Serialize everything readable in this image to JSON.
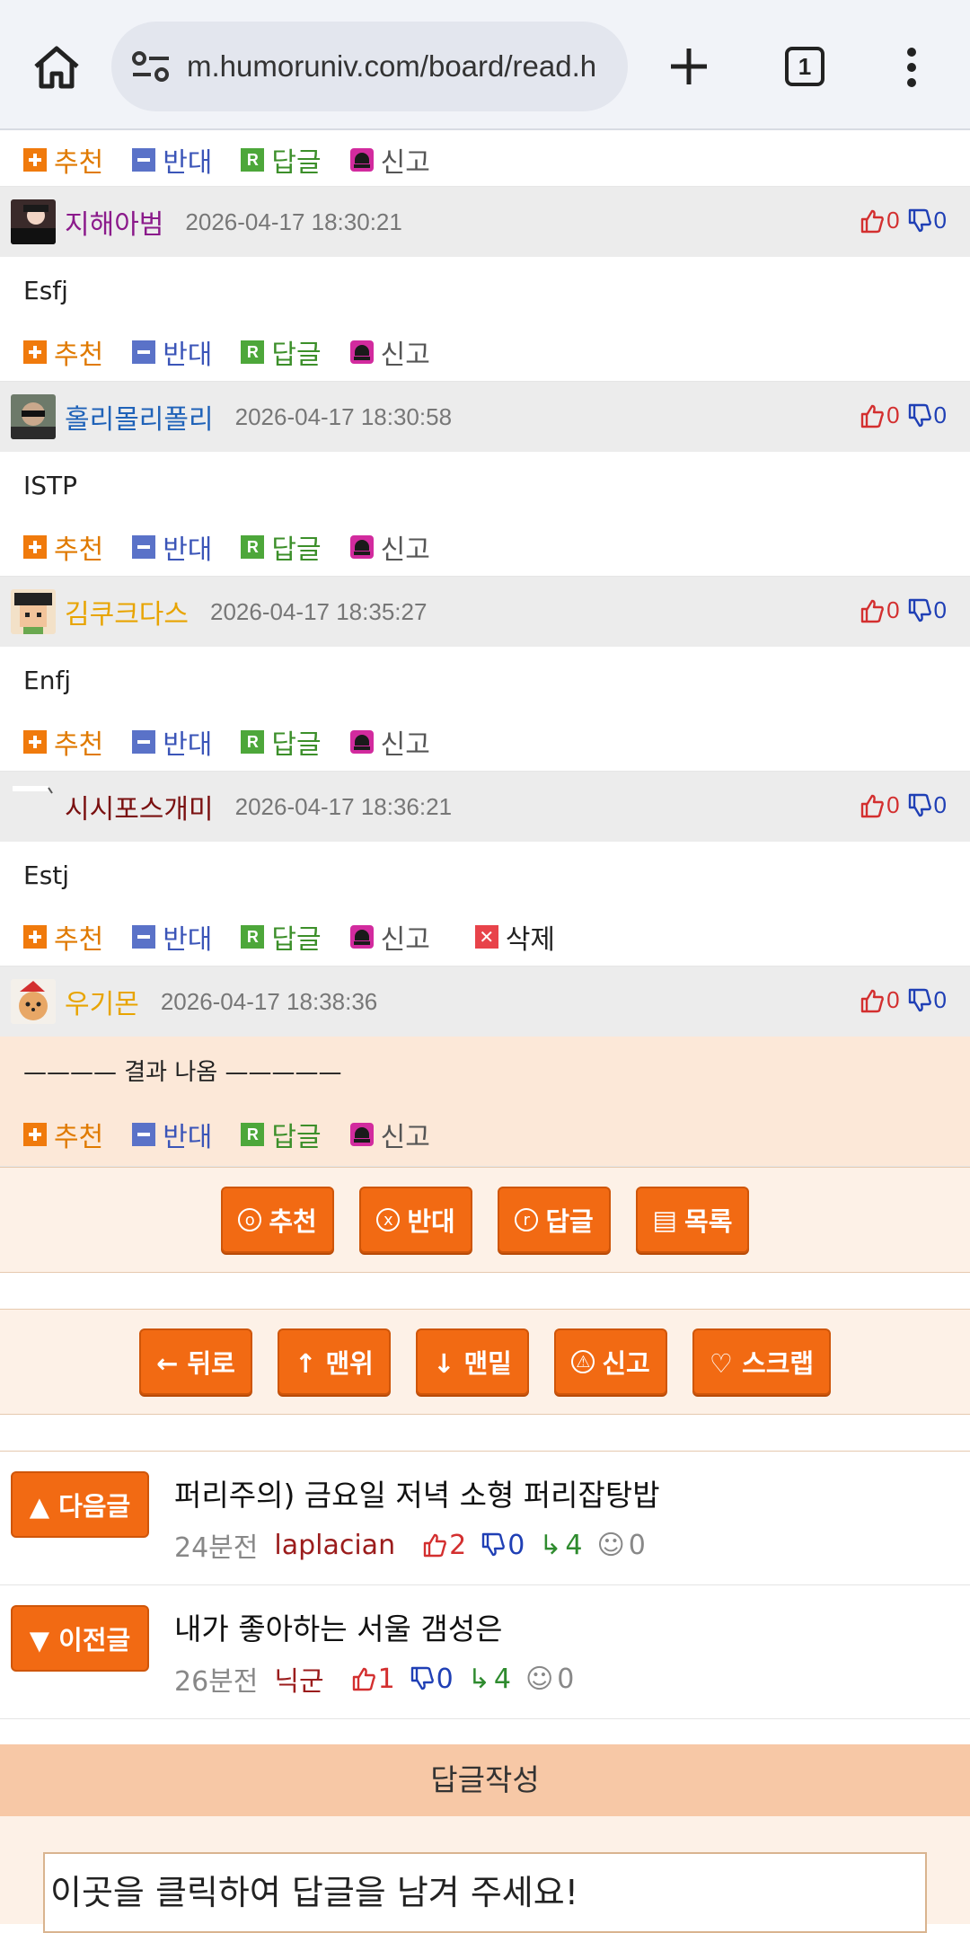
{
  "browser": {
    "url": "m.humoruniv.com/board/read.h",
    "tab_count": "1"
  },
  "actions": {
    "recommend": "추천",
    "oppose": "반대",
    "reply": "답글",
    "report": "신고",
    "delete": "삭제"
  },
  "top_actions_visible": true,
  "comments": [
    {
      "nick": "지해아범",
      "nick_color": "#8b1a8b",
      "date": "2026-04-17 18:30:21",
      "up": "0",
      "down": "0",
      "body": "Esfj"
    },
    {
      "nick": "홀리몰리폴리",
      "nick_color": "#1f62b8",
      "date": "2026-04-17 18:30:58",
      "up": "0",
      "down": "0",
      "body": "ISTP"
    },
    {
      "nick": "김쿠크다스",
      "nick_color": "#e8a400",
      "date": "2026-04-17 18:35:27",
      "up": "0",
      "down": "0",
      "body": "Enfj"
    },
    {
      "nick": "시시포스개미",
      "nick_color": "#7a1010",
      "date": "2026-04-17 18:36:21",
      "up": "0",
      "down": "0",
      "body": "Estj"
    },
    {
      "nick": "우기몬",
      "nick_color": "#e8a400",
      "date": "2026-04-17 18:38:36",
      "up": "0",
      "down": "0",
      "body": "———— 결과 나옴 —————"
    }
  ],
  "post_buttons": {
    "recommend": "추천",
    "oppose": "반대",
    "reply": "답글",
    "list": "목록"
  },
  "nav_buttons": {
    "back": "← 뒤로",
    "top": "↑ 맨위",
    "bottom": "↓ 맨밑",
    "report": "신고",
    "scrap": "♡ 스크랩"
  },
  "next_post": {
    "button": "▲ 다음글",
    "title": "퍼리주의) 금요일 저녁 소형 퍼리잡탕밥",
    "ago": "24분전",
    "author": "laplacian",
    "up": "2",
    "down": "0",
    "replies": "4",
    "views": "0"
  },
  "prev_post": {
    "button": "▼ 이전글",
    "title": "내가 좋아하는 서울 갬성은",
    "ago": "26분전",
    "author": "닉군",
    "up": "1",
    "down": "0",
    "replies": "4",
    "views": "0"
  },
  "reply_write": {
    "header": "답글작성",
    "placeholder": "이곳을 클릭하여 답글을 남겨 주세요!"
  }
}
